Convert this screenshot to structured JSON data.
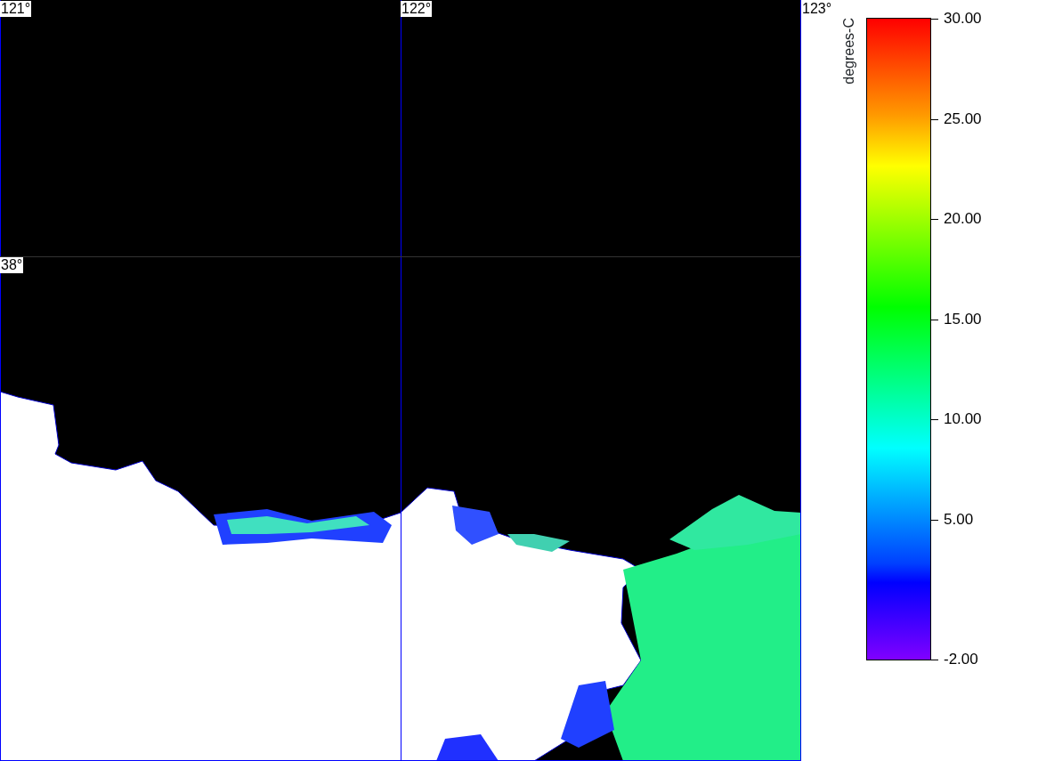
{
  "map": {
    "lon_labels": [
      "121°",
      "122°",
      "123°"
    ],
    "lat_labels": [
      "38°"
    ]
  },
  "colorbar": {
    "unit_label": "degrees-C",
    "tick_labels": [
      "30.00",
      "25.00",
      "20.00",
      "15.00",
      "10.00",
      "5.00",
      "-2.00"
    ]
  }
}
